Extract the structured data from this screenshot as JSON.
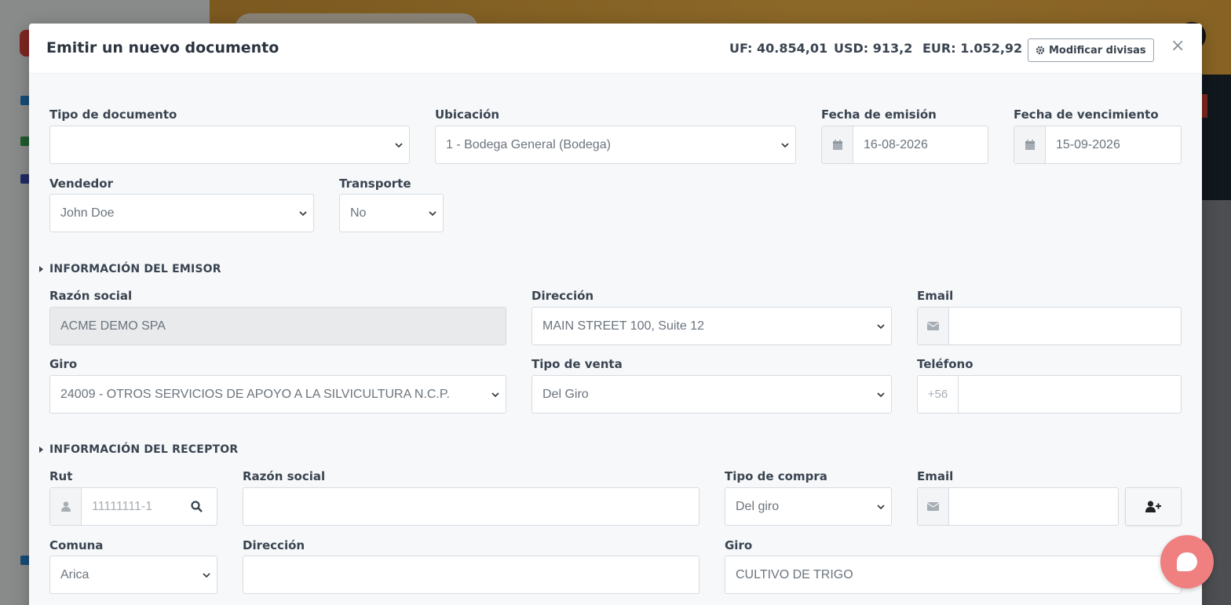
{
  "modal": {
    "title": "Emitir un nuevo documento",
    "rates": {
      "uf": "UF: 40.854,01",
      "usd": "USD: 913,2",
      "eur": "EUR: 1.052,92"
    },
    "modify_currencies_label": "Modificar divisas",
    "close_label": "×"
  },
  "document": {
    "tipo_label": "Tipo de documento",
    "tipo_value": "",
    "ubicacion_label": "Ubicación",
    "ubicacion_value": "1 - Bodega General (Bodega)",
    "fecha_emision_label": "Fecha de emisión",
    "fecha_emision_value": "16-08-2026",
    "fecha_venc_label": "Fecha de vencimiento",
    "fecha_venc_value": "15-09-2026",
    "vendedor_label": "Vendedor",
    "vendedor_value": "John Doe",
    "transporte_label": "Transporte",
    "transporte_value": "No"
  },
  "emisor": {
    "section_title": "INFORMACIÓN DEL EMISOR",
    "razon_label": "Razón social",
    "razon_value": "ACME DEMO SPA",
    "direccion_label": "Dirección",
    "direccion_value": "MAIN STREET 100, Suite 12",
    "email_label": "Email",
    "email_value": "",
    "giro_label": "Giro",
    "giro_value": "24009 - OTROS SERVICIOS DE APOYO A LA SILVICULTURA N.C.P.",
    "tipo_venta_label": "Tipo de venta",
    "tipo_venta_value": "Del Giro",
    "telefono_label": "Teléfono",
    "telefono_prefix": "+56",
    "telefono_value": ""
  },
  "receptor": {
    "section_title": "INFORMACIÓN DEL RECEPTOR",
    "rut_label": "Rut",
    "rut_placeholder": "11111111-1",
    "razon_label": "Razón social",
    "razon_value": "",
    "tipo_compra_label": "Tipo de compra",
    "tipo_compra_value": "Del giro",
    "email_label": "Email",
    "email_value": "",
    "comuna_label": "Comuna",
    "comuna_value": "Arica",
    "direccion_label": "Dirección",
    "direccion_value": "",
    "giro_label": "Giro",
    "giro_value": "CULTIVO DE TRIGO"
  },
  "icons": {
    "calendar": "calendar-icon",
    "envelope": "envelope-icon",
    "user": "user-icon",
    "search": "search-icon",
    "add_user": "user-plus-icon",
    "gear": "gear-icon",
    "chat": "chat-icon"
  },
  "colors": {
    "accent": "#f08080",
    "header": "#ffbe4a"
  }
}
